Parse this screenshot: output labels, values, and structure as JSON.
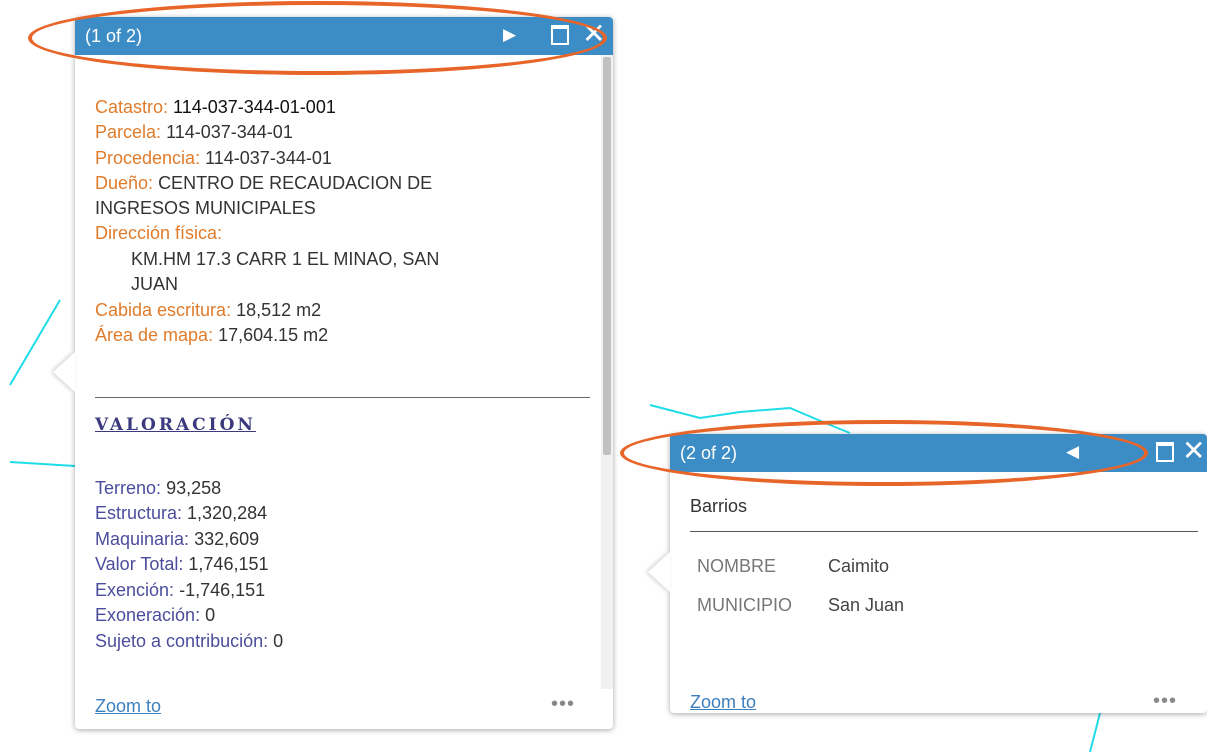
{
  "colors": {
    "titlebar": "#3c8cc5",
    "label_orange": "#e07b2a",
    "label_purple": "#4b4d9c",
    "map_line": "#1fdde8",
    "highlight": "#e8652a",
    "link": "#3c7fbd"
  },
  "popup1": {
    "title": "(1 of 2)",
    "next_icon": "▶",
    "close_icon": "✕",
    "catastro_label": "Catastro:",
    "catastro_value": "114-037-344-01-001",
    "parcela_label": "Parcela:",
    "parcela_value": "114-037-344-01",
    "procedencia_label": "Procedencia:",
    "procedencia_value": "114-037-344-01",
    "dueno_label": "Dueño:",
    "dueno_value_1": "CENTRO DE RECAUDACION DE",
    "dueno_value_2": "INGRESOS MUNICIPALES",
    "direccion_label": "Dirección física:",
    "direccion_value_1": "KM.HM 17.3 CARR 1 EL MINAO, SAN",
    "direccion_value_2": "JUAN",
    "cabida_label": "Cabida escritura:",
    "cabida_value": "18,512 m2",
    "area_label": "Área de mapa:",
    "area_value": "17,604.15 m2",
    "valoracion_heading": "VALORACIÓN",
    "terreno_label": "Terreno:",
    "terreno_value": "93,258",
    "estructura_label": "Estructura:",
    "estructura_value": "1,320,284",
    "maquinaria_label": "Maquinaria:",
    "maquinaria_value": "332,609",
    "valor_total_label": "Valor Total:",
    "valor_total_value": "1,746,151",
    "exencion_label": "Exención:",
    "exencion_value": "-1,746,151",
    "exoneracion_label": "Exoneración:",
    "exoneracion_value": "0",
    "sujeto_label": "Sujeto a contribución:",
    "sujeto_value": "0",
    "zoom_to": "Zoom to",
    "more": "•••"
  },
  "popup2": {
    "title": "(2 of 2)",
    "prev_icon": "◀",
    "close_icon": "✕",
    "layer_title": "Barrios",
    "nombre_key": "NOMBRE",
    "nombre_value": "Caimito",
    "municipio_key": "MUNICIPIO",
    "municipio_value": "San Juan",
    "zoom_to": "Zoom to",
    "more": "•••"
  }
}
